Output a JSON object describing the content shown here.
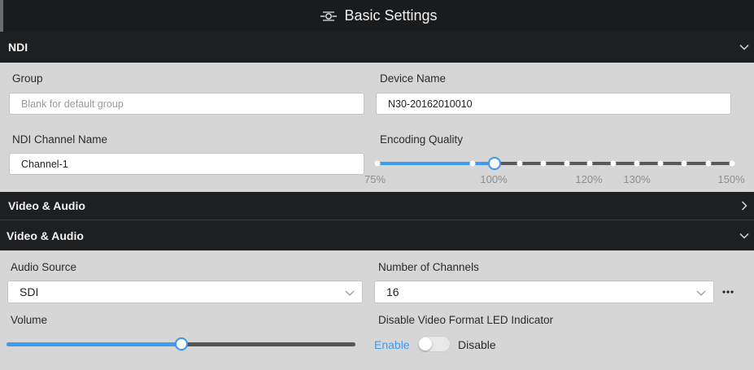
{
  "window": {
    "title": "Basic Settings"
  },
  "ndi_section": {
    "header": "NDI",
    "group": {
      "label": "Group",
      "value": "",
      "placeholder": "Blank for default group"
    },
    "device_name": {
      "label": "Device Name",
      "value": "N30-20162010010"
    },
    "channel_name": {
      "label": "NDI Channel Name",
      "value": "Channel-1"
    },
    "encoding_quality": {
      "label": "Encoding Quality",
      "value_percent": 100,
      "min": 75,
      "max": 150,
      "tick_labels": [
        "75%",
        "100%",
        "120%",
        "130%",
        "150%"
      ]
    }
  },
  "video_audio_collapsed": {
    "header": "Video & Audio"
  },
  "video_audio_section": {
    "header": "Video & Audio",
    "audio_source": {
      "label": "Audio Source",
      "value": "SDI"
    },
    "channels": {
      "label": "Number of Channels",
      "value": "16"
    },
    "volume": {
      "label": "Volume",
      "fraction": 0.5
    },
    "led_indicator": {
      "label": "Disable Video Format LED Indicator",
      "enable_label": "Enable",
      "disable_label": "Disable",
      "state": "Enable"
    }
  },
  "colors": {
    "accent": "#3f9bf0",
    "header_bg": "#1e1f21",
    "panel_bg": "#d6d6d6",
    "track_dark": "#555555"
  }
}
